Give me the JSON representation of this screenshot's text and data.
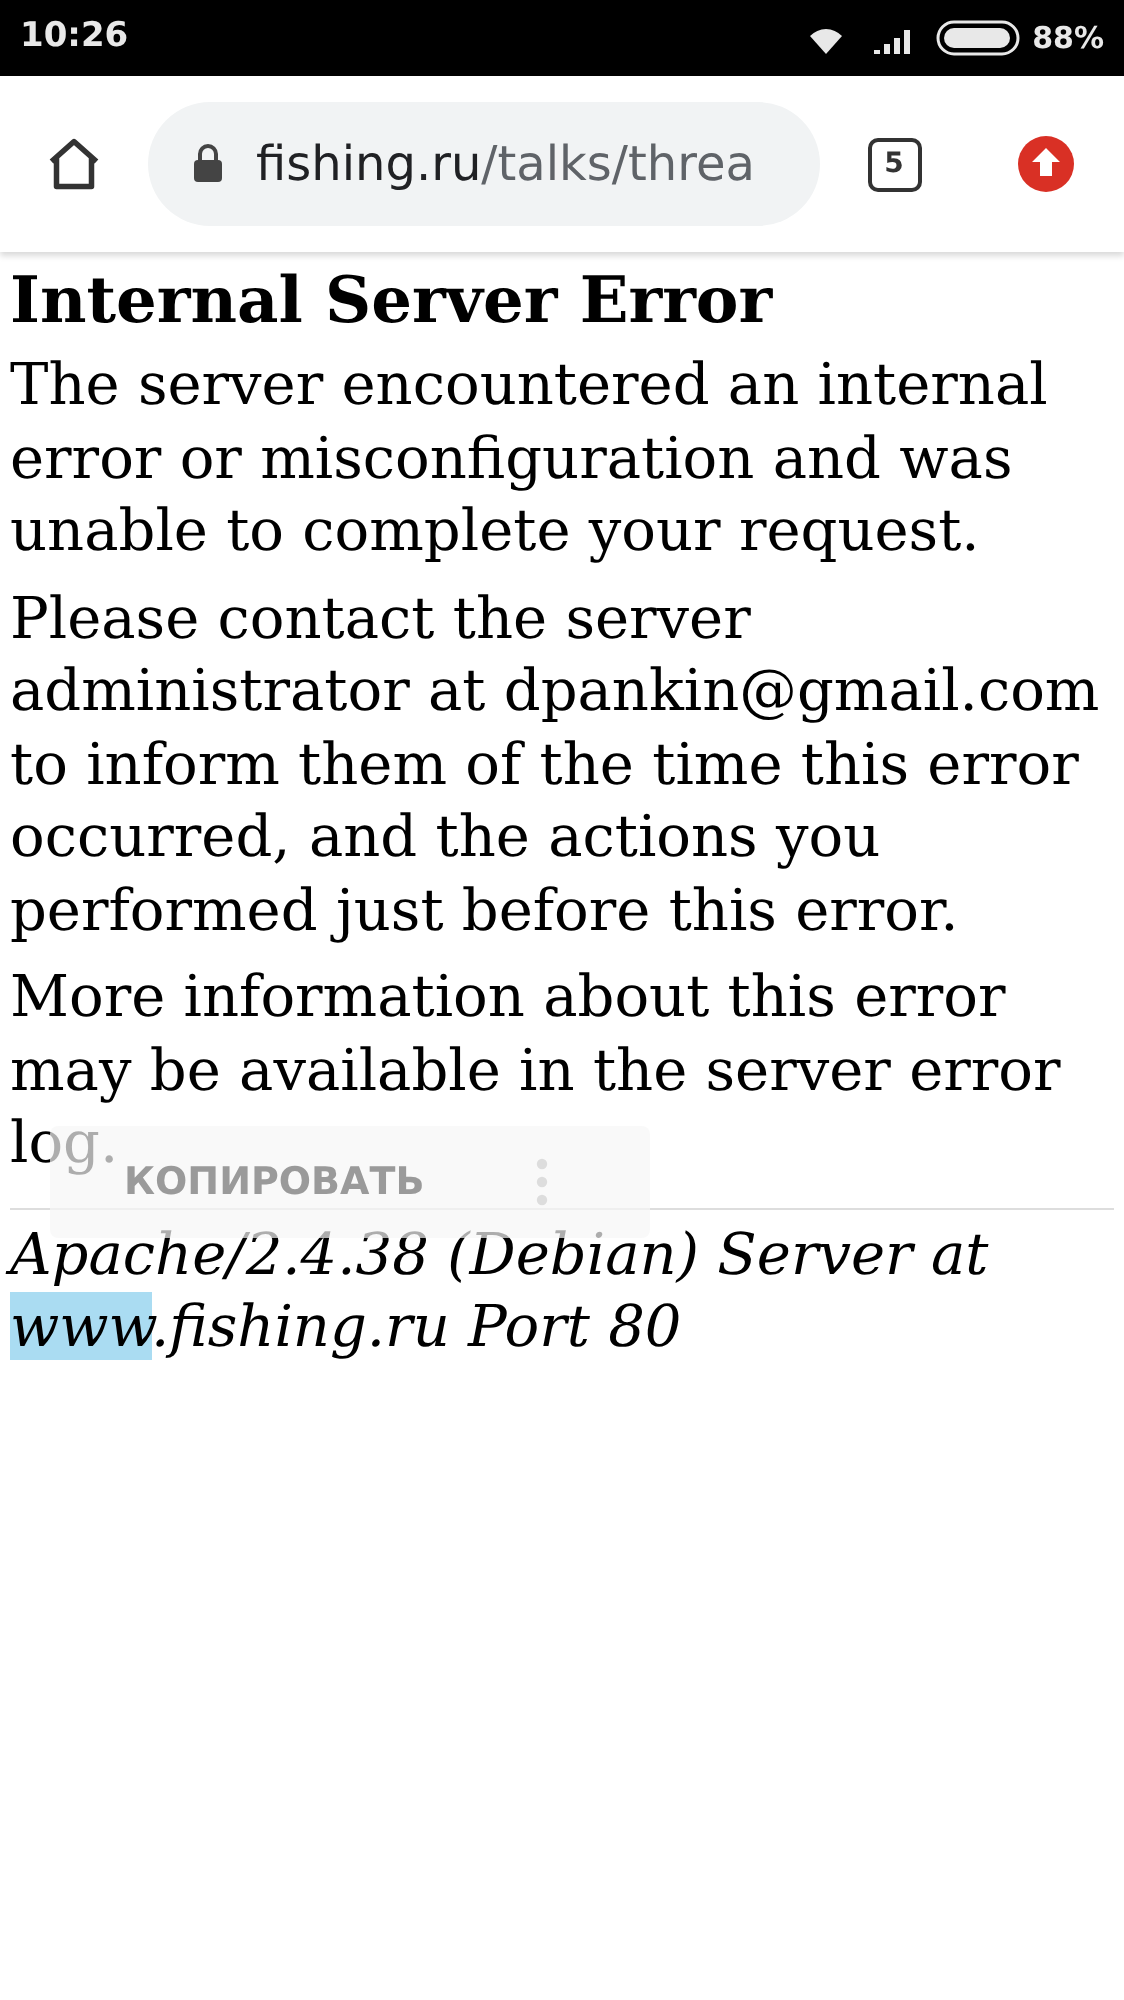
{
  "status_bar": {
    "time": "10:26",
    "battery": "88%"
  },
  "toolbar": {
    "url": {
      "host": "fishing.ru",
      "path": "/talks/threa"
    },
    "tab_count": "5"
  },
  "page": {
    "title": "Internal Server Error",
    "paragraphs": [
      "The server encountered an internal error or misconfiguration and was unable to complete your request.",
      "Please contact the server administrator at dpankin@gmail.com to inform them of the time this error occurred, and the actions you performed just before this error.",
      "More information about this error may be available in the server error log."
    ],
    "signature": {
      "line": "Apache/2.4.38 (Debian) Server at",
      "selected_text": "www",
      "rest": ".fishing.ru Port 80"
    }
  },
  "selection_menu": {
    "action": "КОПИРОВАТЬ"
  }
}
